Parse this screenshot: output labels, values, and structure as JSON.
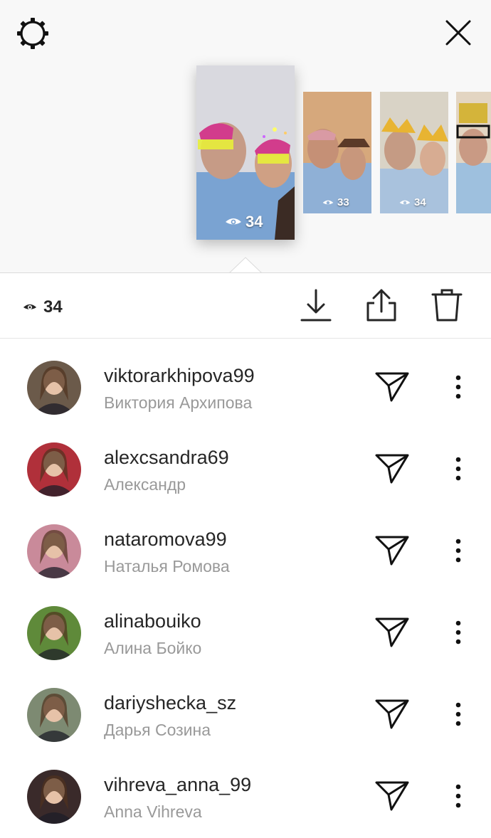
{
  "header": {
    "settings_icon": "gear-icon",
    "close_icon": "close-icon"
  },
  "stories": [
    {
      "views": "34",
      "selected": true
    },
    {
      "views": "33",
      "selected": false
    },
    {
      "views": "34",
      "selected": false
    },
    {
      "views": "",
      "selected": false
    }
  ],
  "toolbar": {
    "view_count": "34",
    "actions": [
      "download-icon",
      "share-icon",
      "trash-icon"
    ]
  },
  "viewers": [
    {
      "username": "viktorarkhipova99",
      "full_name": "Виктория Архипова",
      "avatar_color": "#6b5a4a"
    },
    {
      "username": "alexcsandra69",
      "full_name": "Александр",
      "avatar_color": "#b0303a"
    },
    {
      "username": "nataromova99",
      "full_name": "Наталья Ромова",
      "avatar_color": "#c98a9a"
    },
    {
      "username": "alinabouiko",
      "full_name": "Алина Бойко",
      "avatar_color": "#5f8a3a"
    },
    {
      "username": "dariyshecka_sz",
      "full_name": "Дарья Созина",
      "avatar_color": "#7d8a72"
    },
    {
      "username": "vihreva_anna_99",
      "full_name": "Anna Vihreva",
      "avatar_color": "#3a2a2a"
    }
  ],
  "colors": {
    "background_top": "#f8f8f8",
    "text_primary": "#262626",
    "text_secondary": "#999999",
    "divider": "#dbdbdb"
  }
}
